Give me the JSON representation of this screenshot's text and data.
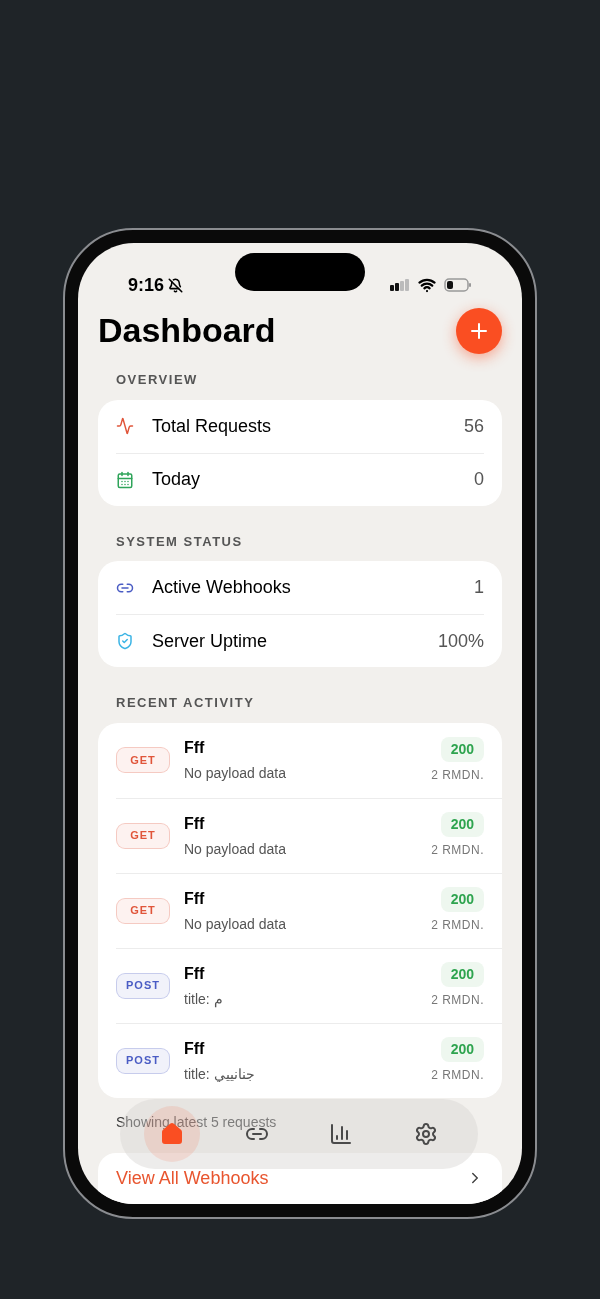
{
  "status_bar": {
    "time": "9:16"
  },
  "title": "Dashboard",
  "sections": [
    {
      "heading": "OVERVIEW",
      "rows": [
        {
          "label": "Total Requests",
          "value": "56"
        },
        {
          "label": "Today",
          "value": "0"
        }
      ]
    },
    {
      "heading": "SYSTEM STATUS",
      "rows": [
        {
          "label": "Active Webhooks",
          "value": "1"
        },
        {
          "label": "Server Uptime",
          "value": "100%"
        }
      ]
    }
  ],
  "recent": {
    "heading": "RECENT ACTIVITY",
    "items": [
      {
        "method": "GET",
        "color": "#e0553a",
        "name": "Fff",
        "detail": "No payload data",
        "status": "200",
        "time": "2 RMDN."
      },
      {
        "method": "GET",
        "color": "#e0553a",
        "name": "Fff",
        "detail": "No payload data",
        "status": "200",
        "time": "2 RMDN."
      },
      {
        "method": "GET",
        "color": "#e0553a",
        "name": "Fff",
        "detail": "No payload data",
        "status": "200",
        "time": "2 RMDN."
      },
      {
        "method": "POST",
        "color": "#4a5cc4",
        "name": "Fff",
        "detail": "title: م",
        "status": "200",
        "time": "2 RMDN."
      },
      {
        "method": "POST",
        "color": "#4a5cc4",
        "name": "Fff",
        "detail": "title: جنانييي",
        "status": "200",
        "time": "2 RMDN."
      }
    ],
    "footer": "Showing latest 5 requests"
  },
  "tab_bar": [
    {
      "selected": true
    },
    {
      "selected": false
    },
    {
      "selected": false
    },
    {
      "selected": false
    }
  ],
  "link": "View All Webhooks"
}
